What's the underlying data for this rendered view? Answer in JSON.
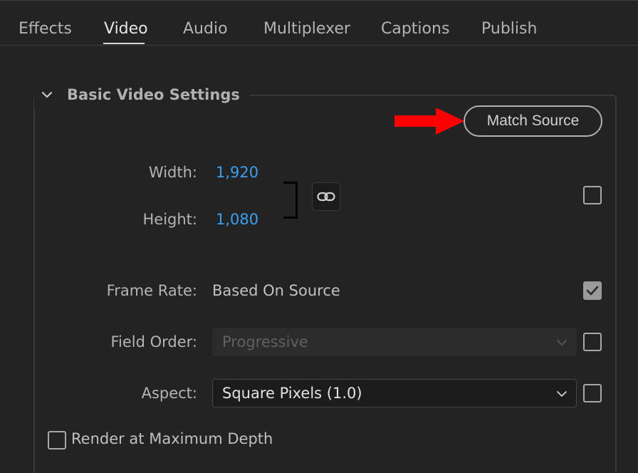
{
  "tabs": [
    {
      "label": "Effects"
    },
    {
      "label": "Video",
      "active": true
    },
    {
      "label": "Audio"
    },
    {
      "label": "Multiplexer"
    },
    {
      "label": "Captions"
    },
    {
      "label": "Publish"
    }
  ],
  "section": {
    "title": "Basic Video Settings",
    "expanded": true,
    "match_source_label": "Match Source"
  },
  "fields": {
    "width": {
      "label": "Width:",
      "value": "1,920"
    },
    "height": {
      "label": "Height:",
      "value": "1,080"
    },
    "dimensions_checked": false,
    "frame_rate": {
      "label": "Frame Rate:",
      "value": "Based On Source",
      "checked": true
    },
    "field_order": {
      "label": "Field Order:",
      "value": "Progressive",
      "disabled": true,
      "checked": false
    },
    "aspect": {
      "label": "Aspect:",
      "value": "Square Pixels (1.0)",
      "checked": false
    },
    "render_max_depth": {
      "label": "Render at Maximum Depth",
      "checked": false
    }
  },
  "icons": {
    "chevron": "chevron-down-icon",
    "link": "link-icon",
    "caret": "caret-down-icon",
    "arrow": "red-arrow-icon"
  },
  "colors": {
    "background": "#232323",
    "value_blue": "#3aa0f2",
    "annotation_arrow": "#ff0000"
  }
}
